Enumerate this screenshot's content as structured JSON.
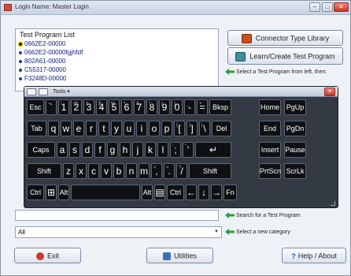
{
  "window": {
    "title": "Login Name: Master Login"
  },
  "list": {
    "title": "Test Program List",
    "items": [
      "0662E2-00000",
      "0662E2-00000fgjhfdf",
      "802A61-00000",
      "C55317-00000",
      "F3248D-00000"
    ]
  },
  "buttons": {
    "connector": "Connector Type Library",
    "learn": "Learn/Create Test Program"
  },
  "hints": {
    "select_program": "Select a Test Program from left, then:",
    "search": "Search for a Test Program",
    "category": "Select a new category"
  },
  "search": {
    "value": ""
  },
  "category": {
    "value": "All"
  },
  "osk": {
    "menu": "Tools",
    "rows": [
      [
        {
          "k": "Esc"
        },
        {
          "k": "`",
          "a": "~"
        },
        {
          "k": "1",
          "a": "!"
        },
        {
          "k": "2",
          "a": "@"
        },
        {
          "k": "3",
          "a": "#"
        },
        {
          "k": "4",
          "a": "$"
        },
        {
          "k": "5",
          "a": "%"
        },
        {
          "k": "6",
          "a": "^"
        },
        {
          "k": "7",
          "a": "&"
        },
        {
          "k": "8",
          "a": "*"
        },
        {
          "k": "9",
          "a": "("
        },
        {
          "k": "0",
          "a": ")"
        },
        {
          "k": "-",
          "a": "_"
        },
        {
          "k": "=",
          "a": "+"
        },
        {
          "k": "Bksp"
        },
        {
          "k": "Home"
        },
        {
          "k": "PgUp"
        }
      ],
      [
        {
          "k": "Tab"
        },
        {
          "k": "q"
        },
        {
          "k": "w"
        },
        {
          "k": "e"
        },
        {
          "k": "r"
        },
        {
          "k": "t"
        },
        {
          "k": "y"
        },
        {
          "k": "u"
        },
        {
          "k": "i"
        },
        {
          "k": "o"
        },
        {
          "k": "p"
        },
        {
          "k": "[",
          "a": "{"
        },
        {
          "k": "]",
          "a": "}"
        },
        {
          "k": "\\",
          "a": "|"
        },
        {
          "k": "Del"
        },
        {
          "k": "End"
        },
        {
          "k": "PgDn"
        }
      ],
      [
        {
          "k": "Caps"
        },
        {
          "k": "a"
        },
        {
          "k": "s"
        },
        {
          "k": "d"
        },
        {
          "k": "f"
        },
        {
          "k": "g"
        },
        {
          "k": "h"
        },
        {
          "k": "j"
        },
        {
          "k": "k"
        },
        {
          "k": "l"
        },
        {
          "k": ";",
          "a": ":"
        },
        {
          "k": "'",
          "a": "\""
        },
        {
          "k": "↵"
        },
        {
          "k": "Insert"
        },
        {
          "k": "Pause"
        }
      ],
      [
        {
          "k": "Shift"
        },
        {
          "k": "z"
        },
        {
          "k": "x"
        },
        {
          "k": "c"
        },
        {
          "k": "v"
        },
        {
          "k": "b"
        },
        {
          "k": "n"
        },
        {
          "k": "m"
        },
        {
          "k": ",",
          "a": "<"
        },
        {
          "k": ".",
          "a": ">"
        },
        {
          "k": "/",
          "a": "?"
        },
        {
          "k": "Shift"
        },
        {
          "k": "PrtScn"
        },
        {
          "k": "ScrLk"
        }
      ],
      [
        {
          "k": "Ctrl"
        },
        {
          "k": "⊞"
        },
        {
          "k": "Alt"
        },
        {
          "k": ""
        },
        {
          "k": "Alt"
        },
        {
          "k": "▤"
        },
        {
          "k": "Ctrl"
        },
        {
          "k": "←"
        },
        {
          "k": "↓"
        },
        {
          "k": "→"
        },
        {
          "k": "Fn"
        }
      ]
    ]
  },
  "footer": {
    "exit": "Exit",
    "utilities": "Utilities",
    "help": "Help / About"
  }
}
